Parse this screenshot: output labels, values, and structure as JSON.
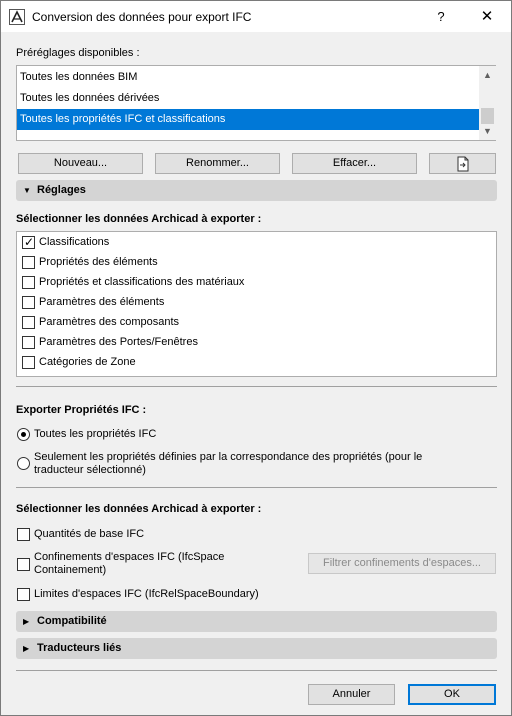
{
  "window": {
    "title": "Conversion des données pour export IFC",
    "help_glyph": "?",
    "close_glyph": "✕"
  },
  "presets": {
    "label": "Préréglages disponibles :",
    "items": [
      {
        "label": "Toutes les données BIM"
      },
      {
        "label": "Toutes les données dérivées"
      },
      {
        "label": "Toutes les propriétés IFC et classifications"
      }
    ],
    "selected_index": 2
  },
  "buttons": {
    "new": "Nouveau...",
    "rename": "Renommer...",
    "delete": "Effacer..."
  },
  "sections": {
    "settings": "Réglages",
    "compatibility": "Compatibilité",
    "linked_translators": "Traducteurs liés"
  },
  "archicad_data": {
    "label": "Sélectionner les données Archicad à exporter :",
    "items": [
      {
        "label": "Classifications",
        "checked": true
      },
      {
        "label": "Propriétés des éléments",
        "checked": false
      },
      {
        "label": "Propriétés et classifications des matériaux",
        "checked": false
      },
      {
        "label": "Paramètres des éléments",
        "checked": false
      },
      {
        "label": "Paramètres des composants",
        "checked": false
      },
      {
        "label": "Paramètres des Portes/Fenêtres",
        "checked": false
      },
      {
        "label": "Catégories de Zone",
        "checked": false
      }
    ]
  },
  "ifc_properties": {
    "label": "Exporter Propriétés IFC :",
    "options": [
      {
        "label": "Toutes les propriétés IFC",
        "selected": true
      },
      {
        "label_line1": "Seulement les propriétés définies par la correspondance des propriétés (pour le",
        "label_line2": "traducteur sélectionné)",
        "selected": false
      }
    ]
  },
  "archicad_data_2": {
    "label": "Sélectionner les données Archicad à exporter :",
    "base_quantities": {
      "label": "Quantités de base IFC",
      "checked": false
    },
    "space_containment": {
      "label_line1": "Confinements d'espaces IFC (IfcSpace",
      "label_line2": "Containement)",
      "checked": false
    },
    "space_boundary": {
      "label": "Limites d'espaces IFC (IfcRelSpaceBoundary)",
      "checked": false
    },
    "filter_button": "Filtrer confinements d'espaces..."
  },
  "footer": {
    "cancel": "Annuler",
    "ok": "OK"
  }
}
